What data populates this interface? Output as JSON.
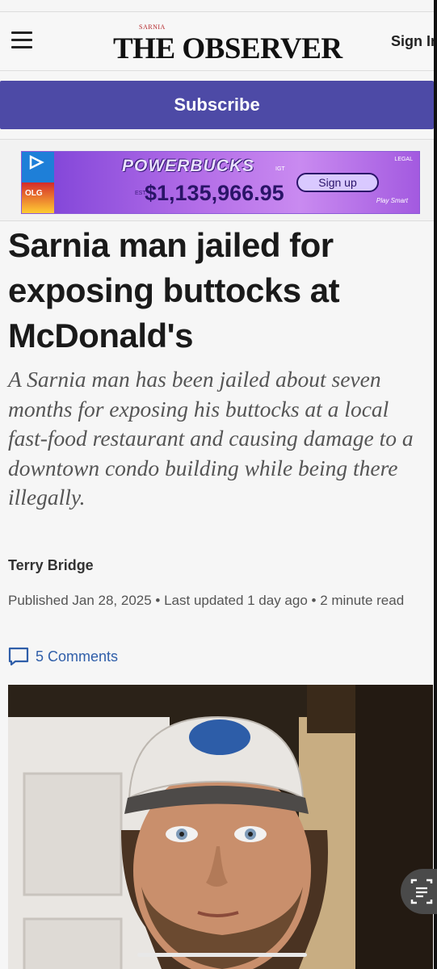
{
  "header": {
    "brand_kicker": "SARNIA",
    "brand_name": "THE OBSERVER",
    "signin_label": "Sign In",
    "menu_icon": "hamburger-menu-icon"
  },
  "subscribe": {
    "label": "Subscribe"
  },
  "ad": {
    "title": "POWERBUCKS",
    "igt": "IGT",
    "est": "EST.",
    "amount": "$1,135,966.95",
    "signup_label": "Sign up",
    "legal": "LEGAL",
    "play_smart": "Play Smart",
    "olg": "OLG"
  },
  "article": {
    "headline": "Sarnia man jailed for exposing buttocks at McDonald's",
    "dek": "A Sarnia man has been jailed about seven months for exposing his buttocks at a local fast-food restaurant and causing damage to a downtown condo building while being there illegally.",
    "author": "Terry Bridge",
    "meta": "Published Jan 28, 2025  •  Last updated 1 day ago  •  2 minute read",
    "comments_label": "5 Comments"
  },
  "colors": {
    "subscribe_bg": "#4d4aa6",
    "link": "#2f5ea9",
    "ad_purple": "#b46ee8"
  }
}
